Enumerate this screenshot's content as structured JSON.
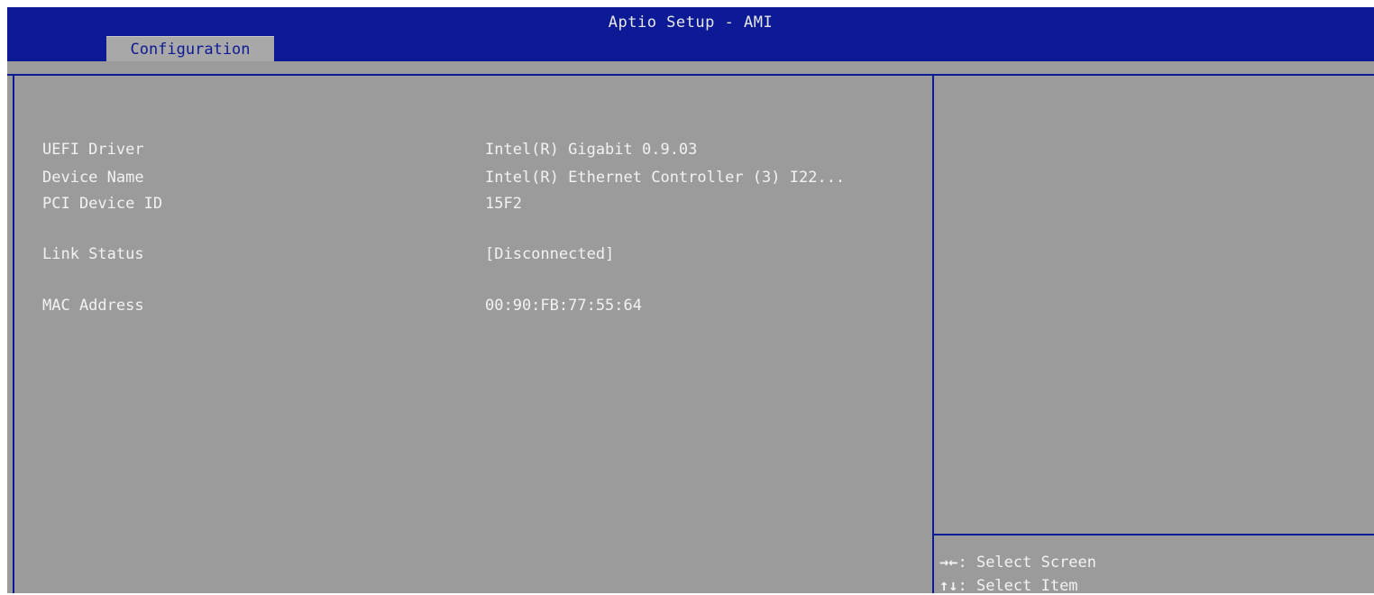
{
  "window": {
    "title": "Aptio Setup - AMI"
  },
  "tabs": [
    {
      "label": "Configuration",
      "active": true
    }
  ],
  "main": {
    "items": [
      {
        "label": "UEFI Driver",
        "value": "Intel(R) Gigabit 0.9.03"
      },
      {
        "label": "Device Name",
        "value": "Intel(R) Ethernet Controller (3) I22..."
      },
      {
        "label": "PCI Device ID",
        "value": "15F2"
      },
      {
        "label": "Link Status",
        "value": "[Disconnected]"
      },
      {
        "label": "MAC Address",
        "value": "00:90:FB:77:55:64"
      }
    ]
  },
  "help": {
    "keys": [
      {
        "key": "→←",
        "desc": ": Select Screen"
      },
      {
        "key": "↑↓",
        "desc": ": Select Item"
      }
    ]
  },
  "colors": {
    "header_blue": "#0d1a95",
    "panel_gray": "#9b9b9b",
    "tab_gray": "#a8a8a8",
    "text_light": "#f2f2f2"
  }
}
